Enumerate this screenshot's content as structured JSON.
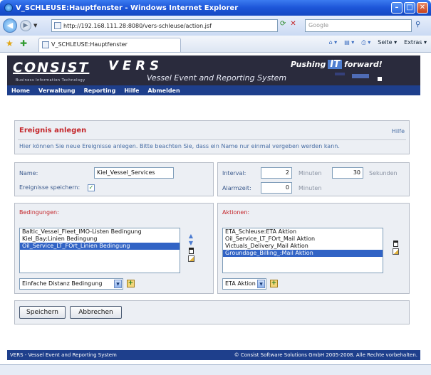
{
  "browser": {
    "title": "V_SCHLEUSE:Hauptfenster - Windows Internet Explorer",
    "url": "http://192.168.111.28:8080/vers-schleuse/action.jsf",
    "search_placeholder": "Google",
    "tab_title": "V_SCHLEUSE:Hauptfenster",
    "commands": {
      "page": "Seite",
      "extras": "Extras"
    }
  },
  "header": {
    "brand": "CONSIST",
    "brand_sub": "Business Information Technology",
    "product": "VERS",
    "product_sub": "Vessel Event and Reporting System",
    "slogan_pre": "Pushing",
    "slogan_it": "IT",
    "slogan_post": "forward!"
  },
  "menu": [
    "Home",
    "Verwaltung",
    "Reporting",
    "Hilfe",
    "Abmelden"
  ],
  "page": {
    "title": "Ereignis anlegen",
    "help": "Hilfe",
    "hint": "Hier können Sie neue Ereignisse anlegen. Bitte beachten Sie, dass ein Name nur einmal vergeben werden kann."
  },
  "form": {
    "name_label": "Name:",
    "name_value": "Kiel_Vessel_Services",
    "save_events_label": "Ereignisse speichern:",
    "save_events_checked": "✓",
    "interval_label": "Interval:",
    "interval_minutes": "2",
    "minutes_unit": "Minuten",
    "interval_seconds": "30",
    "seconds_unit": "Sekunden",
    "alarm_label": "Alarmzeit:",
    "alarm_minutes": "0",
    "alarm_unit": "Minuten"
  },
  "conditions": {
    "label": "Bedingungen:",
    "items": [
      {
        "text": "Baltic_Vessel_Fleet_IMO-Listen Bedingung",
        "selected": false
      },
      {
        "text": "Kiel_Bay:Linien Bedingung",
        "selected": false
      },
      {
        "text": "Oil_Service_LT_FOrt_Linien Bedingung",
        "selected": true
      }
    ],
    "type_select": "Einfache Distanz Bedingung"
  },
  "actions": {
    "label": "Aktionen:",
    "items": [
      {
        "text": "ETA_Schleuse:ETA Aktion",
        "selected": false
      },
      {
        "text": "Oil_Service_LT_FOrt_Mail Aktion",
        "selected": false
      },
      {
        "text": "Victuals_Delivery_Mail Aktion",
        "selected": false
      },
      {
        "text": "Groundage_Billing_:Mail Aktion",
        "selected": true
      }
    ],
    "type_select": "ETA Aktion"
  },
  "buttons": {
    "save": "Speichern",
    "cancel": "Abbrechen"
  },
  "footer": {
    "left": "VERS - Vessel Event and Reporting System",
    "right": "© Consist Software Solutions GmbH 2005-2008. Alle Rechte vorbehalten."
  },
  "colors": {
    "accent": "#c4262a",
    "nav": "#1e3f8c",
    "selection": "#3163c5",
    "header_bg": "#2a2b3d"
  }
}
